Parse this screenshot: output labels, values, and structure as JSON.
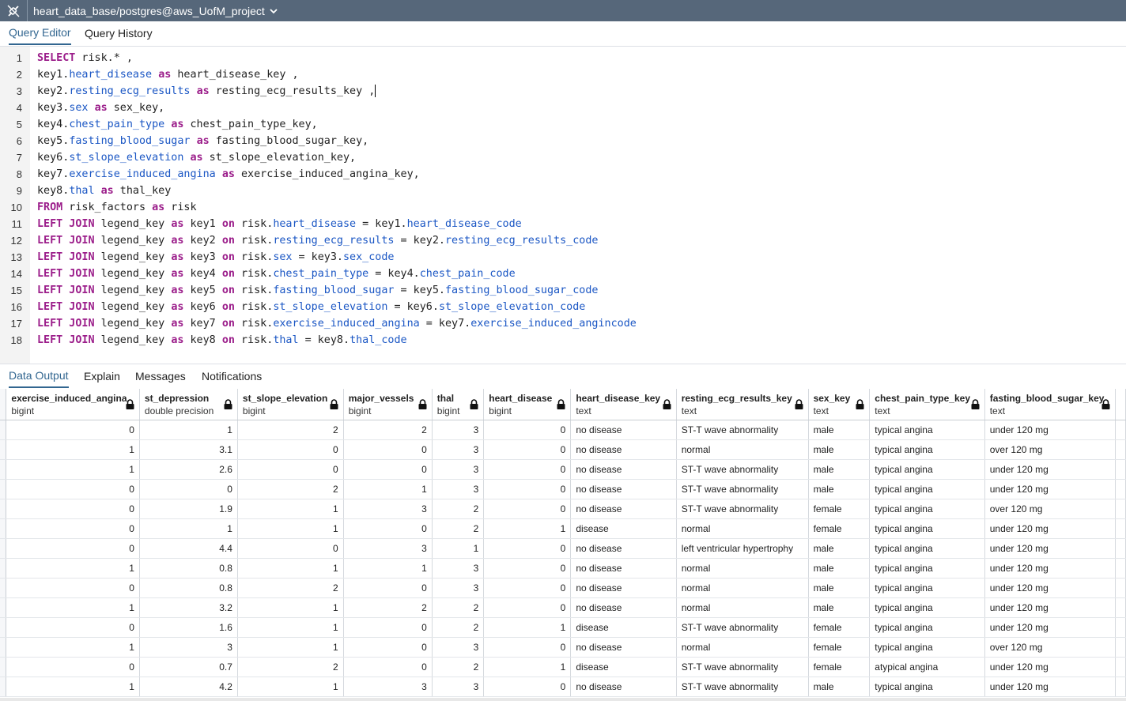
{
  "connection": {
    "label": "heart_data_base/postgres@aws_UofM_project"
  },
  "editor_tabs": [
    {
      "label": "Query Editor"
    },
    {
      "label": "Query History"
    }
  ],
  "editor": {
    "lines": [
      {
        "n": "1",
        "parts": [
          [
            "kw",
            "SELECT"
          ],
          [
            "t",
            " risk.* ,"
          ]
        ]
      },
      {
        "n": "2",
        "parts": [
          [
            "t",
            "key1."
          ],
          [
            "col",
            "heart_disease"
          ],
          [
            "t",
            " "
          ],
          [
            "kw",
            "as"
          ],
          [
            "t",
            " heart_disease_key ,"
          ]
        ]
      },
      {
        "n": "3",
        "parts": [
          [
            "t",
            "key2."
          ],
          [
            "col",
            "resting_ecg_results"
          ],
          [
            "t",
            " "
          ],
          [
            "kw",
            "as"
          ],
          [
            "t",
            " resting_ecg_results_key ,"
          ],
          [
            "caret",
            ""
          ]
        ]
      },
      {
        "n": "4",
        "parts": [
          [
            "t",
            "key3."
          ],
          [
            "col",
            "sex"
          ],
          [
            "t",
            " "
          ],
          [
            "kw",
            "as"
          ],
          [
            "t",
            " sex_key,"
          ]
        ]
      },
      {
        "n": "5",
        "parts": [
          [
            "t",
            "key4."
          ],
          [
            "col",
            "chest_pain_type"
          ],
          [
            "t",
            " "
          ],
          [
            "kw",
            "as"
          ],
          [
            "t",
            " chest_pain_type_key,"
          ]
        ]
      },
      {
        "n": "6",
        "parts": [
          [
            "t",
            "key5."
          ],
          [
            "col",
            "fasting_blood_sugar"
          ],
          [
            "t",
            " "
          ],
          [
            "kw",
            "as"
          ],
          [
            "t",
            " fasting_blood_sugar_key,"
          ]
        ]
      },
      {
        "n": "7",
        "parts": [
          [
            "t",
            "key6."
          ],
          [
            "col",
            "st_slope_elevation"
          ],
          [
            "t",
            " "
          ],
          [
            "kw",
            "as"
          ],
          [
            "t",
            " st_slope_elevation_key,"
          ]
        ]
      },
      {
        "n": "8",
        "parts": [
          [
            "t",
            "key7."
          ],
          [
            "col",
            "exercise_induced_angina"
          ],
          [
            "t",
            " "
          ],
          [
            "kw",
            "as"
          ],
          [
            "t",
            " exercise_induced_angina_key,"
          ]
        ]
      },
      {
        "n": "9",
        "parts": [
          [
            "t",
            "key8."
          ],
          [
            "col",
            "thal"
          ],
          [
            "t",
            " "
          ],
          [
            "kw",
            "as"
          ],
          [
            "t",
            " thal_key"
          ]
        ]
      },
      {
        "n": "10",
        "parts": [
          [
            "kw",
            "FROM"
          ],
          [
            "t",
            " risk_factors "
          ],
          [
            "kw",
            "as"
          ],
          [
            "t",
            " risk"
          ]
        ]
      },
      {
        "n": "11",
        "parts": [
          [
            "kw",
            "LEFT JOIN"
          ],
          [
            "t",
            " legend_key "
          ],
          [
            "kw",
            "as"
          ],
          [
            "t",
            " key1 "
          ],
          [
            "kw",
            "on"
          ],
          [
            "t",
            " risk."
          ],
          [
            "col",
            "heart_disease"
          ],
          [
            "t",
            " = key1."
          ],
          [
            "col",
            "heart_disease_code"
          ]
        ]
      },
      {
        "n": "12",
        "parts": [
          [
            "kw",
            "LEFT JOIN"
          ],
          [
            "t",
            " legend_key "
          ],
          [
            "kw",
            "as"
          ],
          [
            "t",
            " key2 "
          ],
          [
            "kw",
            "on"
          ],
          [
            "t",
            " risk."
          ],
          [
            "col",
            "resting_ecg_results"
          ],
          [
            "t",
            " = key2."
          ],
          [
            "col",
            "resting_ecg_results_code"
          ]
        ]
      },
      {
        "n": "13",
        "parts": [
          [
            "kw",
            "LEFT JOIN"
          ],
          [
            "t",
            " legend_key "
          ],
          [
            "kw",
            "as"
          ],
          [
            "t",
            " key3 "
          ],
          [
            "kw",
            "on"
          ],
          [
            "t",
            " risk."
          ],
          [
            "col",
            "sex"
          ],
          [
            "t",
            " = key3."
          ],
          [
            "col",
            "sex_code"
          ]
        ]
      },
      {
        "n": "14",
        "parts": [
          [
            "kw",
            "LEFT JOIN"
          ],
          [
            "t",
            " legend_key "
          ],
          [
            "kw",
            "as"
          ],
          [
            "t",
            " key4 "
          ],
          [
            "kw",
            "on"
          ],
          [
            "t",
            " risk."
          ],
          [
            "col",
            "chest_pain_type"
          ],
          [
            "t",
            " = key4."
          ],
          [
            "col",
            "chest_pain_code"
          ]
        ]
      },
      {
        "n": "15",
        "parts": [
          [
            "kw",
            "LEFT JOIN"
          ],
          [
            "t",
            " legend_key "
          ],
          [
            "kw",
            "as"
          ],
          [
            "t",
            " key5 "
          ],
          [
            "kw",
            "on"
          ],
          [
            "t",
            " risk."
          ],
          [
            "col",
            "fasting_blood_sugar"
          ],
          [
            "t",
            " = key5."
          ],
          [
            "col",
            "fasting_blood_sugar_code"
          ]
        ]
      },
      {
        "n": "16",
        "parts": [
          [
            "kw",
            "LEFT JOIN"
          ],
          [
            "t",
            " legend_key "
          ],
          [
            "kw",
            "as"
          ],
          [
            "t",
            " key6 "
          ],
          [
            "kw",
            "on"
          ],
          [
            "t",
            " risk."
          ],
          [
            "col",
            "st_slope_elevation"
          ],
          [
            "t",
            " = key6."
          ],
          [
            "col",
            "st_slope_elevation_code"
          ]
        ]
      },
      {
        "n": "17",
        "parts": [
          [
            "kw",
            "LEFT JOIN"
          ],
          [
            "t",
            " legend_key "
          ],
          [
            "kw",
            "as"
          ],
          [
            "t",
            " key7 "
          ],
          [
            "kw",
            "on"
          ],
          [
            "t",
            " risk."
          ],
          [
            "col",
            "exercise_induced_angina"
          ],
          [
            "t",
            " = key7."
          ],
          [
            "col",
            "exercise_induced_angincode"
          ]
        ]
      },
      {
        "n": "18",
        "parts": [
          [
            "kw",
            "LEFT JOIN"
          ],
          [
            "t",
            " legend_key "
          ],
          [
            "kw",
            "as"
          ],
          [
            "t",
            " key8 "
          ],
          [
            "kw",
            "on"
          ],
          [
            "t",
            " risk."
          ],
          [
            "col",
            "thal"
          ],
          [
            "t",
            " = key8."
          ],
          [
            "col",
            "thal_code"
          ]
        ]
      }
    ]
  },
  "output_tabs": [
    {
      "label": "Data Output"
    },
    {
      "label": "Explain"
    },
    {
      "label": "Messages"
    },
    {
      "label": "Notifications"
    }
  ],
  "grid": {
    "columns": [
      {
        "name": "exercise_induced_angina",
        "type": "bigint",
        "numeric": true
      },
      {
        "name": "st_depression",
        "type": "double precision",
        "numeric": true
      },
      {
        "name": "st_slope_elevation",
        "type": "bigint",
        "numeric": true
      },
      {
        "name": "major_vessels",
        "type": "bigint",
        "numeric": true
      },
      {
        "name": "thal",
        "type": "bigint",
        "numeric": true
      },
      {
        "name": "heart_disease",
        "type": "bigint",
        "numeric": true
      },
      {
        "name": "heart_disease_key",
        "type": "text",
        "numeric": false
      },
      {
        "name": "resting_ecg_results_key",
        "type": "text",
        "numeric": false
      },
      {
        "name": "sex_key",
        "type": "text",
        "numeric": false
      },
      {
        "name": "chest_pain_type_key",
        "type": "text",
        "numeric": false
      },
      {
        "name": "fasting_blood_sugar_key",
        "type": "text",
        "numeric": false
      }
    ],
    "rows": [
      [
        "0",
        "1",
        "2",
        "2",
        "3",
        "0",
        "no disease",
        "ST-T wave abnormality",
        "male",
        "typical angina",
        "under 120 mg"
      ],
      [
        "1",
        "3.1",
        "0",
        "0",
        "3",
        "0",
        "no disease",
        "normal",
        "male",
        "typical angina",
        "over 120 mg"
      ],
      [
        "1",
        "2.6",
        "0",
        "0",
        "3",
        "0",
        "no disease",
        "ST-T wave abnormality",
        "male",
        "typical angina",
        "under 120 mg"
      ],
      [
        "0",
        "0",
        "2",
        "1",
        "3",
        "0",
        "no disease",
        "ST-T wave abnormality",
        "male",
        "typical angina",
        "under 120 mg"
      ],
      [
        "0",
        "1.9",
        "1",
        "3",
        "2",
        "0",
        "no disease",
        "ST-T wave abnormality",
        "female",
        "typical angina",
        "over 120 mg"
      ],
      [
        "0",
        "1",
        "1",
        "0",
        "2",
        "1",
        "disease",
        "normal",
        "female",
        "typical angina",
        "under 120 mg"
      ],
      [
        "0",
        "4.4",
        "0",
        "3",
        "1",
        "0",
        "no disease",
        "left ventricular hypertrophy",
        "male",
        "typical angina",
        "under 120 mg"
      ],
      [
        "1",
        "0.8",
        "1",
        "1",
        "3",
        "0",
        "no disease",
        "normal",
        "male",
        "typical angina",
        "under 120 mg"
      ],
      [
        "0",
        "0.8",
        "2",
        "0",
        "3",
        "0",
        "no disease",
        "normal",
        "male",
        "typical angina",
        "under 120 mg"
      ],
      [
        "1",
        "3.2",
        "1",
        "2",
        "2",
        "0",
        "no disease",
        "normal",
        "male",
        "typical angina",
        "under 120 mg"
      ],
      [
        "0",
        "1.6",
        "1",
        "0",
        "2",
        "1",
        "disease",
        "ST-T wave abnormality",
        "female",
        "typical angina",
        "under 120 mg"
      ],
      [
        "1",
        "3",
        "1",
        "0",
        "3",
        "0",
        "no disease",
        "normal",
        "female",
        "typical angina",
        "over 120 mg"
      ],
      [
        "0",
        "0.7",
        "2",
        "0",
        "2",
        "1",
        "disease",
        "ST-T wave abnormality",
        "female",
        "atypical angina",
        "under 120 mg"
      ],
      [
        "1",
        "4.2",
        "1",
        "3",
        "3",
        "0",
        "no disease",
        "ST-T wave abnormality",
        "male",
        "typical angina",
        "under 120 mg"
      ]
    ]
  }
}
